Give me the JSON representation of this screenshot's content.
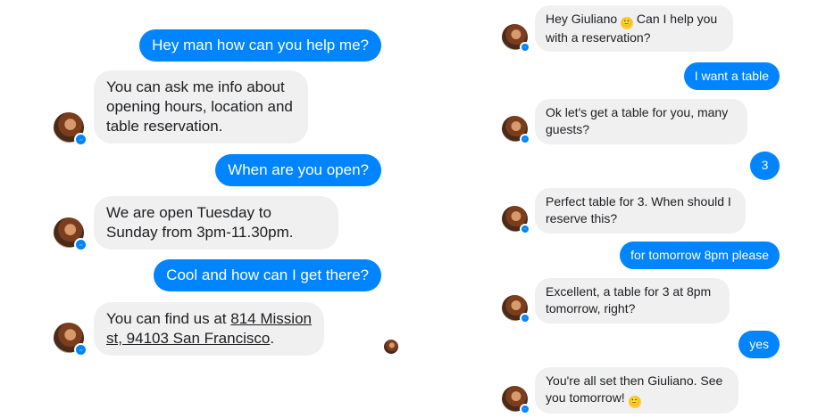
{
  "left_chat": {
    "messages": [
      {
        "from": "user",
        "text": "Hey man how can you help me?"
      },
      {
        "from": "bot",
        "text": "You can ask me info about opening hours, location and table reservation."
      },
      {
        "from": "user",
        "text": "When are you open?"
      },
      {
        "from": "bot",
        "text": "We are open Tuesday to Sunday from 3pm-11.30pm."
      },
      {
        "from": "user",
        "text": "Cool and how can I get there?"
      },
      {
        "from": "bot",
        "text_prefix": "You can find us at ",
        "link": "814 Mission st, 94103 San Francisco",
        "text_suffix": "."
      }
    ]
  },
  "right_chat": {
    "messages": [
      {
        "from": "bot",
        "text": "Hey Giuliano",
        "emoji": "🙂",
        "text_after": " Can I help you with a reservation?"
      },
      {
        "from": "user",
        "text": "I want a table"
      },
      {
        "from": "bot",
        "text": "Ok let's get a table for you, many guests?"
      },
      {
        "from": "user",
        "text": "3"
      },
      {
        "from": "bot",
        "text": "Perfect table for 3. When should I reserve this?"
      },
      {
        "from": "user",
        "text": "for tomorrow 8pm please"
      },
      {
        "from": "bot",
        "text": "Excellent, a table for 3 at 8pm tomorrow, right?"
      },
      {
        "from": "user",
        "text": "yes"
      },
      {
        "from": "bot",
        "text": "You're all set then Giuliano. See you tomorrow! ",
        "emoji": "🙂"
      }
    ]
  },
  "icons": {
    "avatar": "bot-avatar-icon",
    "badge": "messenger-badge-icon",
    "read_receipt": "seen-avatar-icon"
  },
  "colors": {
    "outgoing_bubble": "#0084ff",
    "incoming_bubble": "#f1f0f0",
    "incoming_text": "#1c1e21"
  }
}
